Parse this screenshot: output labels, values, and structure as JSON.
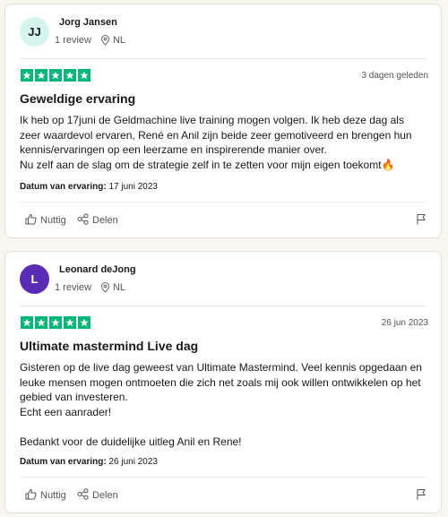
{
  "reviews": [
    {
      "initials": "JJ",
      "avatar_bg": "#d6f5ee",
      "avatar_fg": "#1c1c1c",
      "name": "Jorg Jansen",
      "review_count": "1 review",
      "country": "NL",
      "rating": 5,
      "rating_color": "#00b67a",
      "date": "3 dagen geleden",
      "title": "Geweldige ervaring",
      "body": [
        "Ik heb op 17juni de Geldmachine live training mogen volgen. Ik heb deze dag als zeer waardevol ervaren, René en Anil zijn beide zeer gemotiveerd en brengen hun kennis/ervaringen op een leerzame en inspirerende manier over.",
        "Nu zelf aan de slag om de strategie zelf in te zetten voor mijn eigen toekomt🔥"
      ],
      "experience_label": "Datum van ervaring:",
      "experience_date": "17 juni 2023",
      "useful_label": "Nuttig",
      "share_label": "Delen"
    },
    {
      "initials": "L",
      "avatar_bg": "#5a2bb5",
      "avatar_fg": "#ffffff",
      "name": "Leonard deJong",
      "review_count": "1 review",
      "country": "NL",
      "rating": 5,
      "rating_color": "#00b67a",
      "date": "26 jun 2023",
      "title": "Ultimate mastermind Live dag",
      "body": [
        "Gisteren op de live dag geweest van Ultimate Mastermind. Veel kennis opgedaan en leuke mensen mogen ontmoeten die zich net zoals mij ook willen ontwikkelen op het gebied van investeren.",
        "Echt een aanrader!",
        "",
        "Bedankt voor de duidelijke uitleg Anil en Rene!"
      ],
      "experience_label": "Datum van ervaring:",
      "experience_date": "26 juni 2023",
      "useful_label": "Nuttig",
      "share_label": "Delen"
    }
  ]
}
